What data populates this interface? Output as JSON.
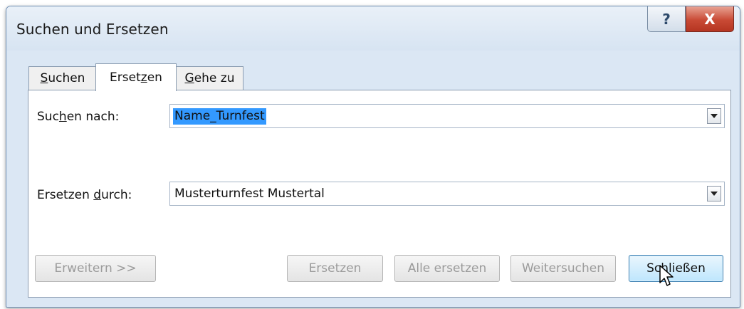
{
  "window": {
    "title": "Suchen und Ersetzen",
    "help_label": "?",
    "close_label": "X"
  },
  "tabs": [
    {
      "pre": "",
      "accel": "S",
      "post": "uchen",
      "active": false
    },
    {
      "pre": "Erset",
      "accel": "z",
      "post": "en",
      "active": true
    },
    {
      "pre": "",
      "accel": "G",
      "post": "ehe zu",
      "active": false
    }
  ],
  "find": {
    "label_pre": "Suc",
    "label_accel": "h",
    "label_post": "en nach:",
    "value": "Name_Turnfest"
  },
  "replace": {
    "label_pre": "Ersetzen ",
    "label_accel": "d",
    "label_post": "urch:",
    "value": "Musterturnfest Mustertal"
  },
  "buttons": {
    "more": "Erweitern >>",
    "replace": "Ersetzen",
    "replace_all": "Alle ersetzen",
    "find_next": "Weitersuchen",
    "close": "Schließen"
  },
  "colors": {
    "selection": "#3399ff",
    "close_button": "#c94a35"
  }
}
